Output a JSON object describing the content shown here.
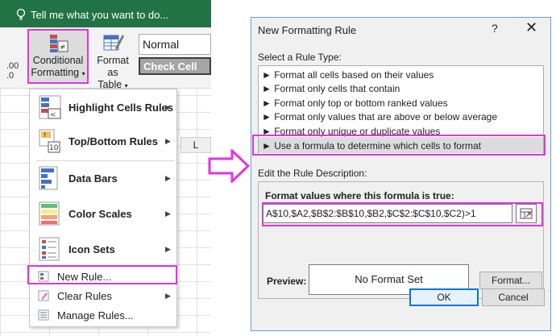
{
  "tell_me": {
    "text": "Tell me what you want to do..."
  },
  "ribbon": {
    "number_format": ".00\n.0",
    "conditional_formatting": {
      "line1": "Conditional",
      "line2": "Formatting"
    },
    "format_as_table": {
      "line1": "Format as",
      "line2": "Table"
    },
    "styles": {
      "normal": "Normal",
      "check_cell": "Check Cell"
    }
  },
  "sheet": {
    "column_l": "L"
  },
  "cf_menu": {
    "items": [
      {
        "label": "Highlight Cells Rules",
        "icon": "highlight-cells-icon"
      },
      {
        "label": "Top/Bottom Rules",
        "icon": "top-bottom-icon"
      },
      {
        "label": "Data Bars",
        "icon": "data-bars-icon"
      },
      {
        "label": "Color Scales",
        "icon": "color-scales-icon"
      },
      {
        "label": "Icon Sets",
        "icon": "icon-sets-icon"
      },
      {
        "label": "New Rule...",
        "icon": "new-rule-icon"
      },
      {
        "label": "Clear Rules",
        "icon": "clear-rules-icon"
      },
      {
        "label": "Manage Rules...",
        "icon": "manage-rules-icon"
      }
    ]
  },
  "dialog": {
    "title": "New Formatting Rule",
    "help": "?",
    "close": "✕",
    "select_rule_type_label": "Select a Rule Type:",
    "rule_types": [
      "► Format all cells based on their values",
      "► Format only cells that contain",
      "► Format only top or bottom ranked values",
      "► Format only values that are above or below average",
      "► Format only unique or duplicate values",
      "► Use a formula to determine which cells to format"
    ],
    "selected_rule_index": 5,
    "edit_description_label": "Edit the Rule Description:",
    "format_values_label": "Format values where this formula is true:",
    "formula": "A$10,$A2,$B$2:$B$10,$B2,$C$2:$C$10,$C2)>1",
    "preview_label": "Preview:",
    "preview_text": "No Format Set",
    "format_button": "Format...",
    "ok_button": "OK",
    "cancel_button": "Cancel"
  },
  "colors": {
    "excel_green": "#217346",
    "highlight": "#e134e1"
  }
}
